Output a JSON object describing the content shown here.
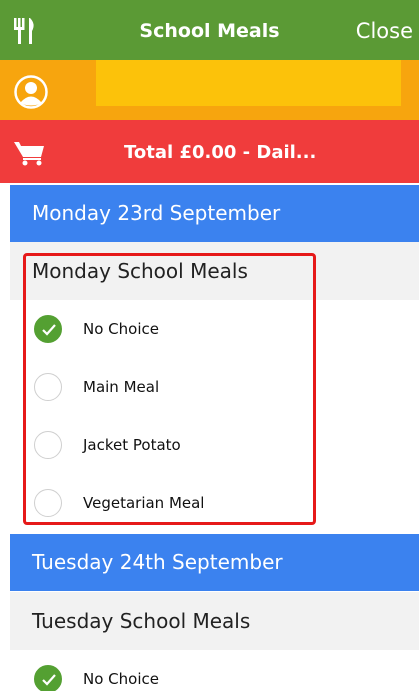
{
  "header": {
    "title": "School Meals",
    "close_label": "Close",
    "icon": "fork-knife-icon"
  },
  "user": {
    "icon": "user-icon",
    "name": ""
  },
  "cart": {
    "icon": "cart-icon",
    "total_text": "Total £0.00 - Dail..."
  },
  "days": [
    {
      "day_title": "Monday 23rd September",
      "meal_section": "Monday School Meals",
      "options": [
        {
          "label": "No Choice",
          "selected": true
        },
        {
          "label": "Main Meal",
          "selected": false
        },
        {
          "label": "Jacket Potato",
          "selected": false
        },
        {
          "label": "Vegetarian Meal",
          "selected": false
        }
      ]
    },
    {
      "day_title": "Tuesday 24th September",
      "meal_section": "Tuesday School Meals",
      "options": [
        {
          "label": "No Choice",
          "selected": true
        }
      ]
    }
  ],
  "colors": {
    "header_green": "#5b9a35",
    "user_orange": "#f7a50e",
    "cart_red": "#f03c3c",
    "day_blue": "#3b82ef",
    "selected_green": "#54a032",
    "highlight_red": "#e61919"
  }
}
